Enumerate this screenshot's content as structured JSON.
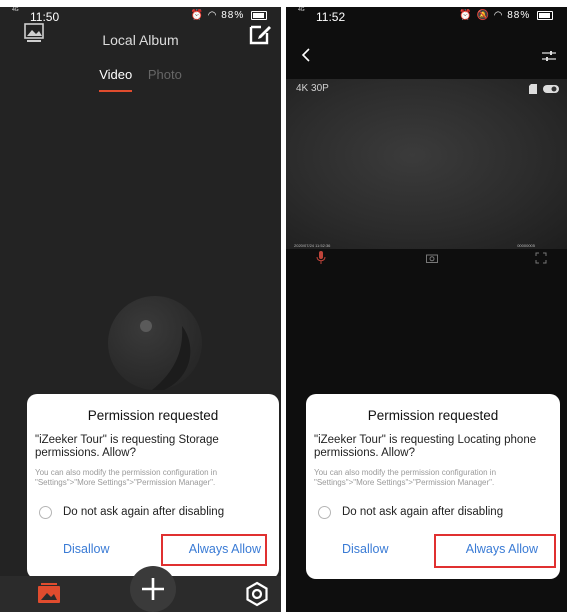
{
  "left_screen": {
    "status": {
      "time": "11:50",
      "network": "4G",
      "battery": "88%"
    },
    "title": "Local Album",
    "tabs": [
      {
        "label": "Video",
        "active": true
      },
      {
        "label": "Photo",
        "active": false
      }
    ],
    "dialog": {
      "title": "Permission requested",
      "message": "\"iZeeker Tour\" is requesting Storage permissions. Allow?",
      "note": "You can also modify the permission configuration in \"Settings\">\"More Settings\">\"Permission Manager\".",
      "checkbox_label": "Do not ask again after disabling",
      "disallow_label": "Disallow",
      "allow_label": "Always Allow"
    },
    "icons": [
      "gallery-icon",
      "edit-icon",
      "album-icon",
      "add-icon",
      "settings-icon"
    ]
  },
  "right_screen": {
    "status": {
      "time": "11:52",
      "network": "4G",
      "battery": "88%"
    },
    "resolution_label": "4K 30P",
    "timestamp": "2020/07/24 11:52:36",
    "frame_counter": "00000005",
    "dialog": {
      "title": "Permission requested",
      "message": "\"iZeeker Tour\" is requesting Locating phone permissions. Allow?",
      "note": "You can also modify the permission configuration in \"Settings\">\"More Settings\">\"Permission Manager\".",
      "checkbox_label": "Do not ask again after disabling",
      "disallow_label": "Disallow",
      "allow_label": "Always Allow"
    },
    "icons": [
      "back-icon",
      "adjust-icon",
      "sd-card-icon",
      "toggle-icon",
      "microphone-icon",
      "camera-icon",
      "fullscreen-icon"
    ]
  },
  "colors": {
    "accent": "#e04c2e",
    "link_blue": "#3a7bd5",
    "highlight_red": "#e03030"
  }
}
